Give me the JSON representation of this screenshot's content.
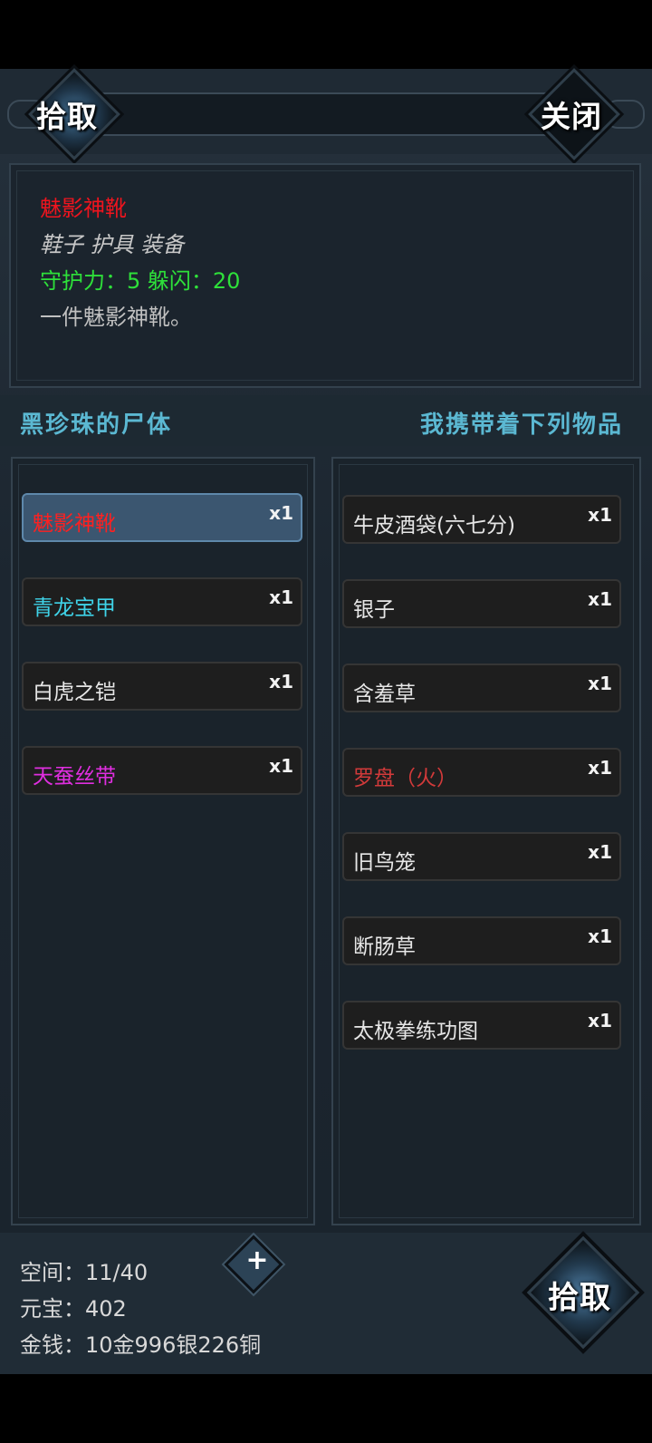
{
  "header": {
    "pick_label": "拾取",
    "close_label": "关闭"
  },
  "detail": {
    "name": "魅影神靴",
    "type": "鞋子 护具 装备",
    "stats": "守护力：5 躲闪：20",
    "description": "一件魅影神靴。"
  },
  "section": {
    "left_title": "黑珍珠的尸体",
    "right_title": "我携带着下列物品"
  },
  "corpse_items": [
    {
      "name": "魅影神靴",
      "qty": "x1",
      "color": "#ff2020"
    },
    {
      "name": "青龙宝甲",
      "qty": "x1",
      "color": "#3fd3e8"
    },
    {
      "name": "白虎之铠",
      "qty": "x1",
      "color": "#e6e6e6"
    },
    {
      "name": "天蚕丝带",
      "qty": "x1",
      "color": "#e02ee0"
    }
  ],
  "my_items": [
    {
      "name": "牛皮酒袋(六七分)",
      "qty": "x1",
      "color": "#e6e6e6"
    },
    {
      "name": "银子",
      "qty": "x1",
      "color": "#e6e6e6"
    },
    {
      "name": "含羞草",
      "qty": "x1",
      "color": "#e6e6e6"
    },
    {
      "name": "罗盘（火）",
      "qty": "x1",
      "color": "#d23a3a"
    },
    {
      "name": "旧鸟笼",
      "qty": "x1",
      "color": "#e6e6e6"
    },
    {
      "name": "断肠草",
      "qty": "x1",
      "color": "#e6e6e6"
    },
    {
      "name": "太极拳练功图",
      "qty": "x1",
      "color": "#e6e6e6"
    }
  ],
  "footer": {
    "space": "空间：11/40",
    "yuanbao": "元宝：402",
    "money": "金钱：10金996银226铜",
    "expand_icon": "plus-icon",
    "pick_label": "拾取"
  }
}
